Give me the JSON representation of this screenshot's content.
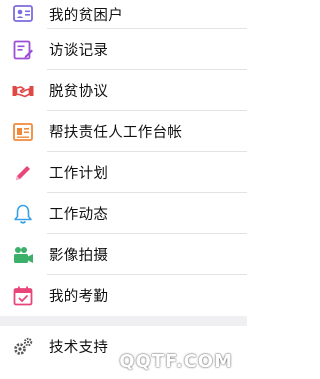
{
  "menu": {
    "items": [
      {
        "label": "我的贫困户",
        "icon": "user-card-icon",
        "color": "#7b6be0"
      },
      {
        "label": "访谈记录",
        "icon": "edit-document-icon",
        "color": "#9b4fd8"
      },
      {
        "label": "脱贫协议",
        "icon": "handshake-icon",
        "color": "#e04848"
      },
      {
        "label": "帮扶责任人工作台帐",
        "icon": "ledger-icon",
        "color": "#f08a3a"
      },
      {
        "label": "工作计划",
        "icon": "pencil-icon",
        "color": "#e8467a"
      },
      {
        "label": "工作动态",
        "icon": "bell-icon",
        "color": "#39a0e6"
      },
      {
        "label": "影像拍摄",
        "icon": "video-camera-icon",
        "color": "#3cb06a"
      },
      {
        "label": "我的考勤",
        "icon": "calendar-check-icon",
        "color": "#e8467a"
      }
    ]
  },
  "bottom": {
    "label": "技术支持",
    "icon": "gears-icon",
    "color": "#555555"
  },
  "watermark": "QQTF.COM"
}
